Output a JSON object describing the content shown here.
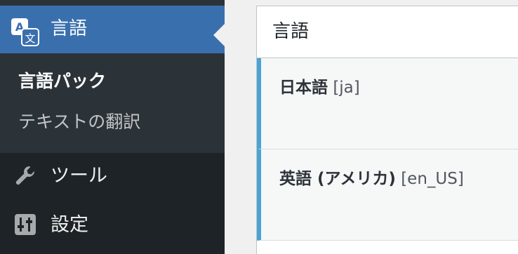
{
  "sidebar": {
    "active_item": {
      "label": "言語",
      "icon": "translate-icon"
    },
    "submenu": [
      {
        "label": "言語パック",
        "current": true
      },
      {
        "label": "テキストの翻訳",
        "current": false
      }
    ],
    "menu": [
      {
        "label": "ツール",
        "icon": "wrench-icon"
      },
      {
        "label": "設定",
        "icon": "settings-sliders-icon"
      }
    ]
  },
  "panel": {
    "title": "言語",
    "languages": [
      {
        "name": "日本語",
        "code": "[ja]"
      },
      {
        "name": "英語 (アメリカ)",
        "code": "[en_US]"
      }
    ]
  },
  "colors": {
    "sidebar_bg": "#1d2327",
    "submenu_bg": "#2c3338",
    "active_bg": "#3a6fae",
    "row_accent": "#4aa3d4"
  }
}
